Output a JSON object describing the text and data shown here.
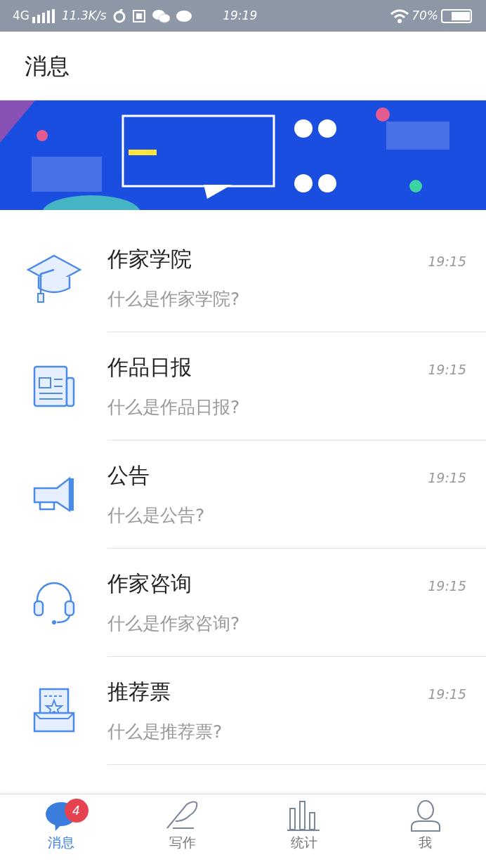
{
  "status_bar": {
    "network": "4G",
    "speed": "11.3K/s",
    "time": "19:19",
    "battery": "70%"
  },
  "header": {
    "title": "消息"
  },
  "messages": [
    {
      "title": "作家学院",
      "subtitle": "什么是作家学院?",
      "time": "19:15"
    },
    {
      "title": "作品日报",
      "subtitle": "什么是作品日报?",
      "time": "19:15"
    },
    {
      "title": "公告",
      "subtitle": "什么是公告?",
      "time": "19:15"
    },
    {
      "title": "作家咨询",
      "subtitle": "什么是作家咨询?",
      "time": "19:15"
    },
    {
      "title": "推荐票",
      "subtitle": "什么是推荐票?",
      "time": "19:15"
    }
  ],
  "tab_bar": [
    {
      "label": "消息",
      "selected": true,
      "badge": "4"
    },
    {
      "label": "写作",
      "selected": false
    },
    {
      "label": "统计",
      "selected": false
    },
    {
      "label": "我",
      "selected": false
    }
  ]
}
